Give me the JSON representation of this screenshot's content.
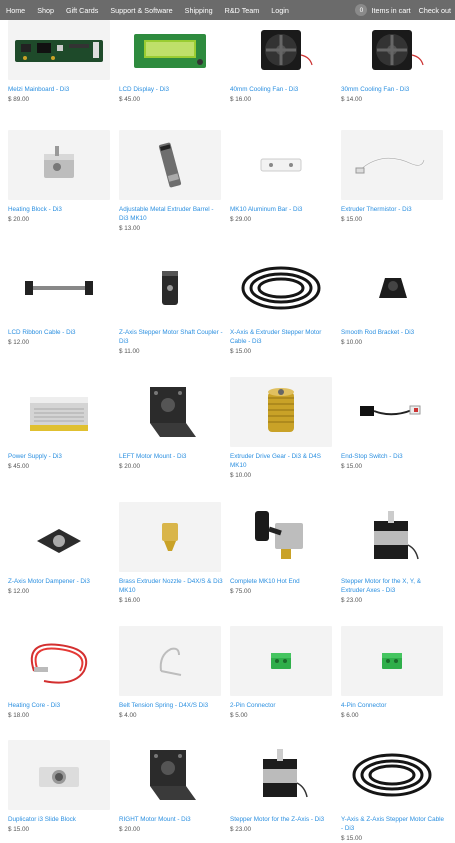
{
  "nav": {
    "items": [
      "Home",
      "Shop",
      "Gift Cards",
      "Support & Software",
      "Shipping",
      "R&D Team",
      "Login"
    ],
    "cart_count": "0",
    "cart_label": "Items in cart",
    "checkout_label": "Check out"
  },
  "products": [
    {
      "title": "Melzi Mainboard - Di3",
      "price": "$ 89.00",
      "icon": "mainboard-image"
    },
    {
      "title": "LCD Display - Di3",
      "price": "$ 45.00",
      "icon": "lcd-display-image"
    },
    {
      "title": "40mm Cooling Fan - Di3",
      "price": "$ 16.00",
      "icon": "cooling-fan-image"
    },
    {
      "title": "30mm Cooling Fan - Di3",
      "price": "$ 14.00",
      "icon": "cooling-fan-image"
    },
    {
      "title": "Heating Block - Di3",
      "price": "$ 20.00",
      "icon": "heating-block-image"
    },
    {
      "title": "Adjustable Metal Extruder Barrel - Di3 MK10",
      "price": "$ 13.00",
      "icon": "extruder-barrel-image"
    },
    {
      "title": "MK10 Aluminum Bar - Di3",
      "price": "$ 29.00",
      "icon": "aluminum-bar-image"
    },
    {
      "title": "Extruder Thermistor - Di3",
      "price": "$ 15.00",
      "icon": "thermistor-image"
    },
    {
      "title": "LCD Ribbon Cable - Di3",
      "price": "$ 12.00",
      "icon": "ribbon-cable-image"
    },
    {
      "title": "Z-Axis Stepper Motor Shaft Coupler - Di3",
      "price": "$ 11.00",
      "icon": "shaft-coupler-image"
    },
    {
      "title": "X-Axis & Extruder Stepper Motor Cable - Di3",
      "price": "$ 15.00",
      "icon": "motor-cable-image"
    },
    {
      "title": "Smooth Rod Bracket - Di3",
      "price": "$ 10.00",
      "icon": "rod-bracket-image"
    },
    {
      "title": "Power Supply - Di3",
      "price": "$ 45.00",
      "icon": "power-supply-image"
    },
    {
      "title": "LEFT Motor Mount - Di3",
      "price": "$ 20.00",
      "icon": "motor-mount-image"
    },
    {
      "title": "Extruder Drive Gear - Di3 & D4S MK10",
      "price": "$ 10.00",
      "icon": "drive-gear-image"
    },
    {
      "title": "End-Stop Switch - Di3",
      "price": "$ 15.00",
      "icon": "endstop-switch-image"
    },
    {
      "title": "Z-Axis Motor Dampener - Di3",
      "price": "$ 12.00",
      "icon": "motor-dampener-image"
    },
    {
      "title": "Brass Extruder Nozzle - D4X/S & Di3 MK10",
      "price": "$ 16.00",
      "icon": "brass-nozzle-image"
    },
    {
      "title": "Complete MK10 Hot End",
      "price": "$ 75.00",
      "icon": "hot-end-image"
    },
    {
      "title": "Stepper Motor for the X, Y, & Extruder Axes - Di3",
      "price": "$ 23.00",
      "icon": "stepper-motor-image"
    },
    {
      "title": "Heating Core - Di3",
      "price": "$ 18.00",
      "icon": "heating-core-image"
    },
    {
      "title": "Belt Tension Spring - D4X/S Di3",
      "price": "$ 4.00",
      "icon": "tension-spring-image"
    },
    {
      "title": "2-Pin Connector",
      "price": "$ 5.00",
      "icon": "connector-image"
    },
    {
      "title": "4-Pin Connector",
      "price": "$ 6.00",
      "icon": "connector-image"
    },
    {
      "title": "Duplicator i3 Slide Block",
      "price": "$ 15.00",
      "icon": "slide-block-image"
    },
    {
      "title": "RIGHT Motor Mount - Di3",
      "price": "$ 20.00",
      "icon": "motor-mount-image"
    },
    {
      "title": "Stepper Motor for the Z-Axis - Di3",
      "price": "$ 23.00",
      "icon": "stepper-motor-image"
    },
    {
      "title": "Y-Axis & Z-Axis Stepper Motor Cable - Di3",
      "price": "$ 15.00",
      "icon": "motor-cable-image"
    }
  ]
}
